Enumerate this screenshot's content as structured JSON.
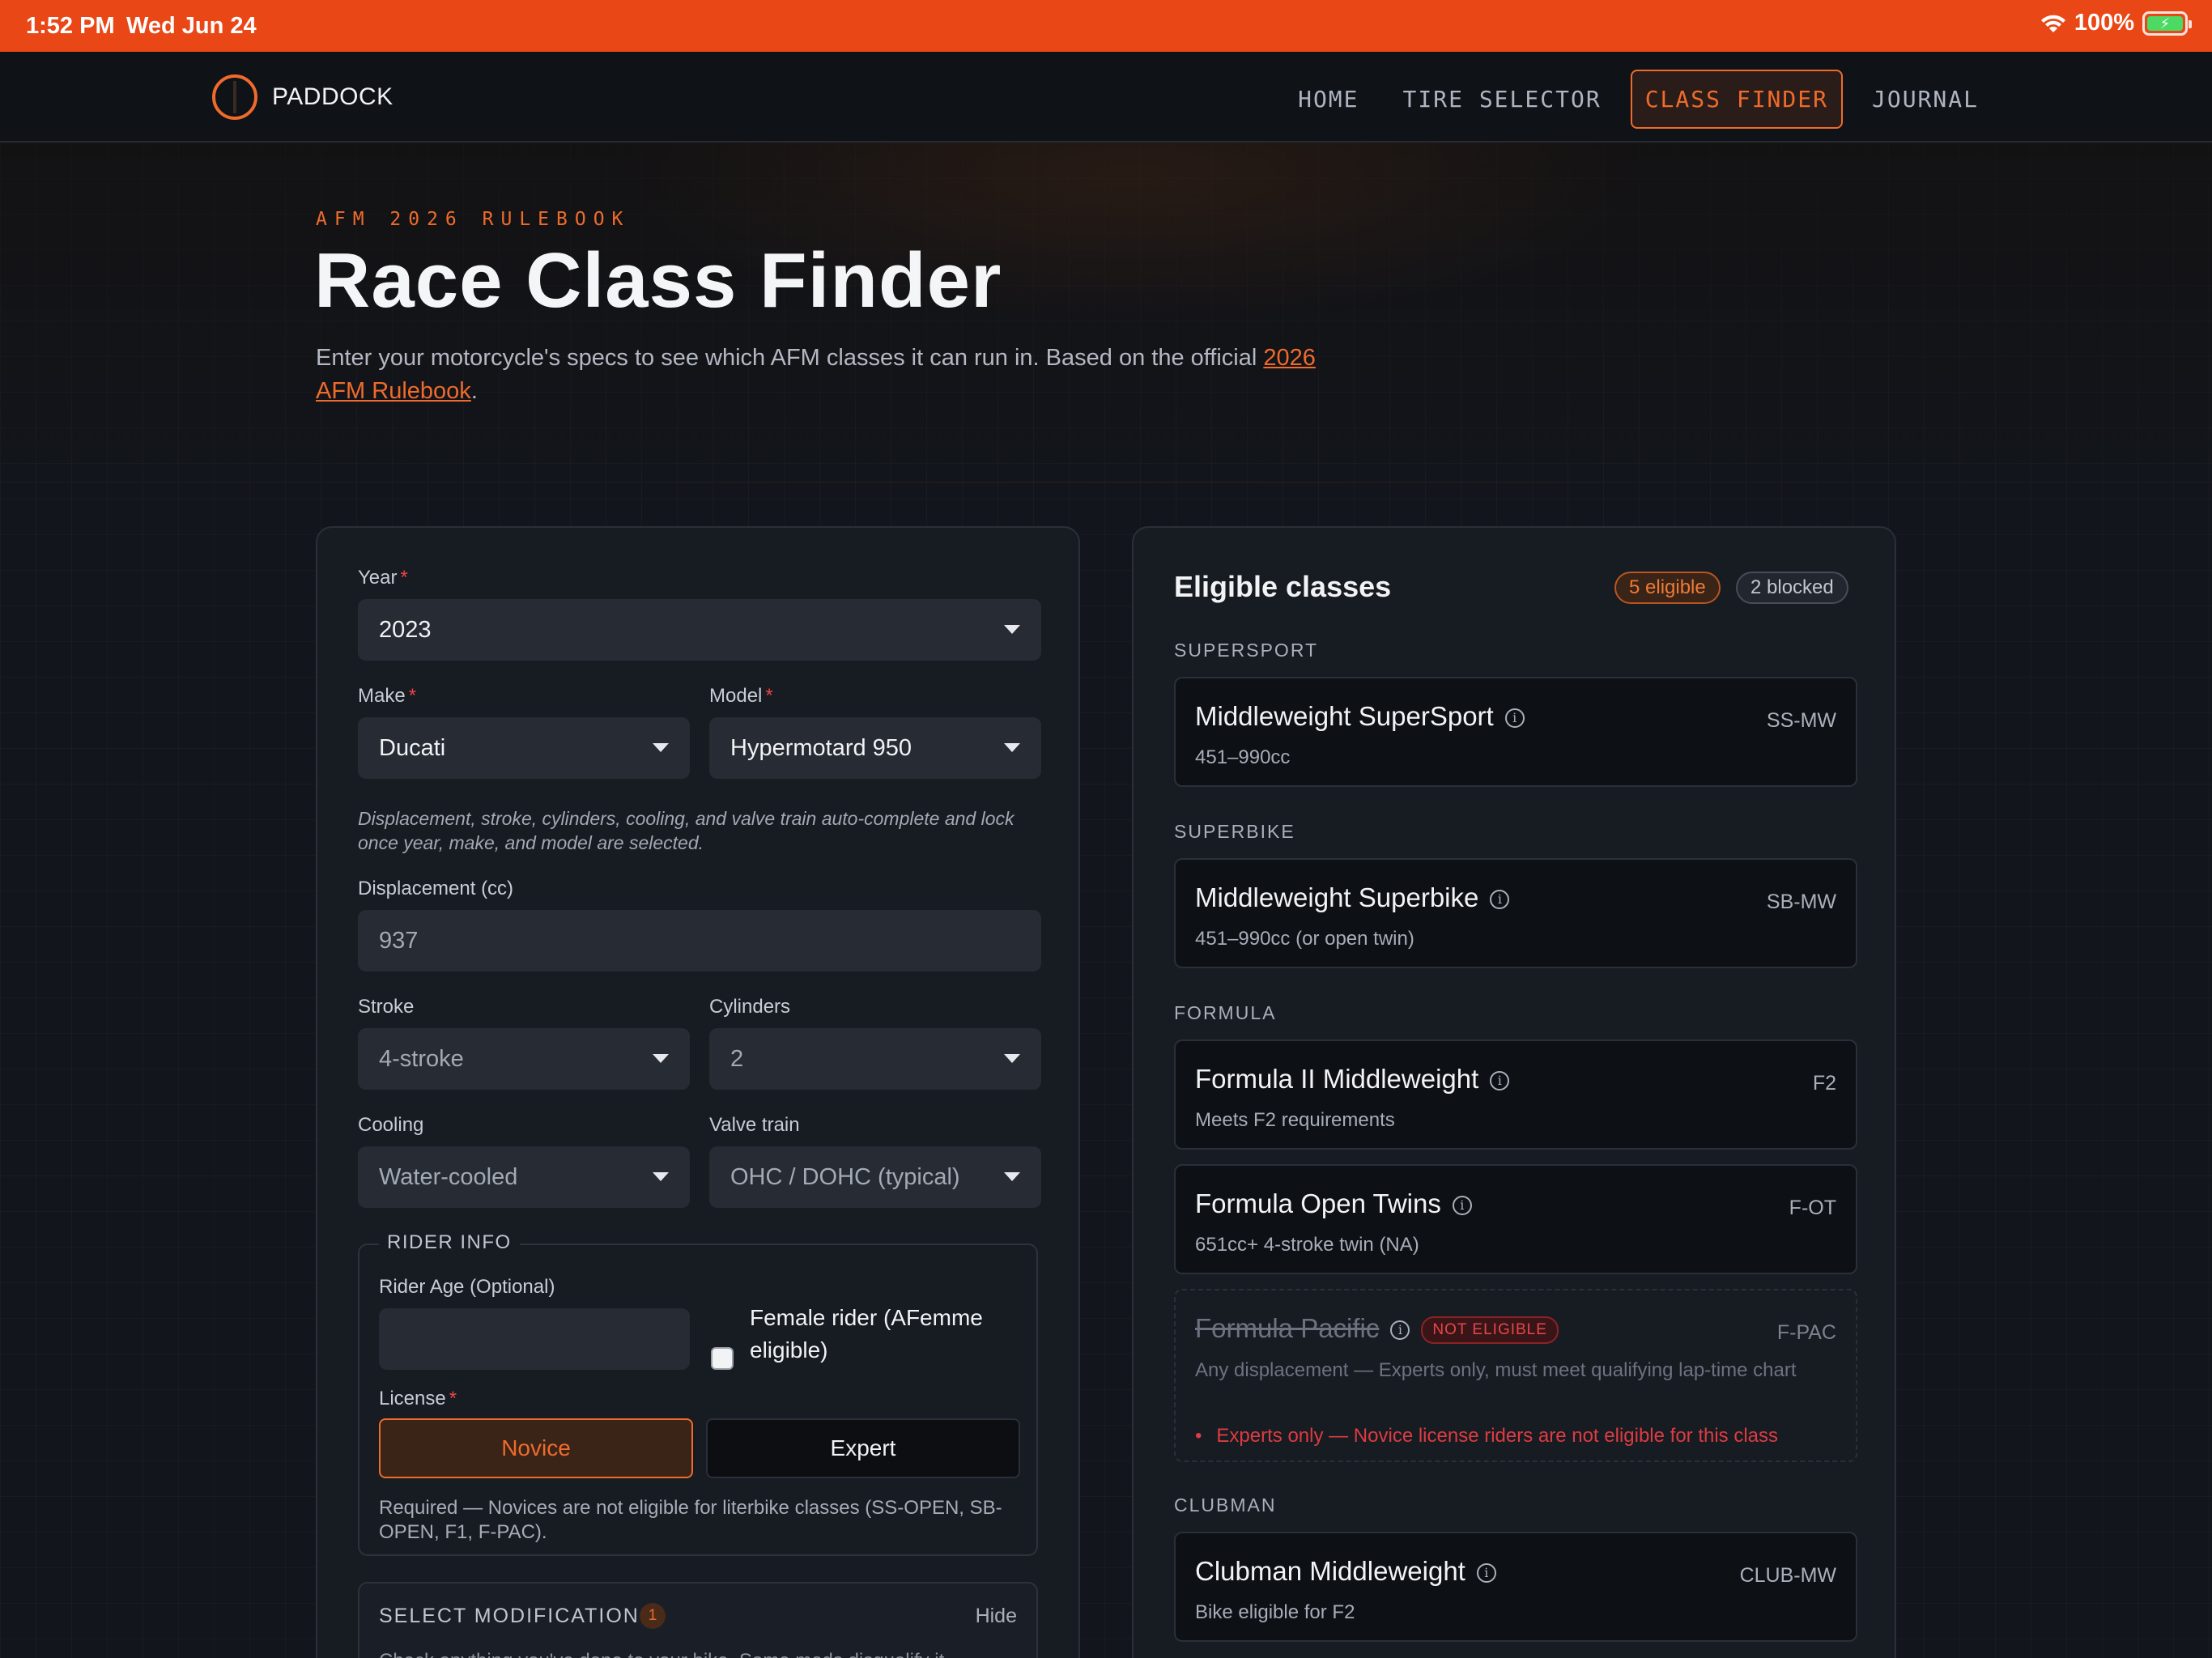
{
  "status_bar": {
    "time": "1:52 PM",
    "date": "Wed Jun 24",
    "battery": "100%"
  },
  "nav": {
    "logo": "PADDOCK",
    "links": [
      "HOME",
      "TIRE SELECTOR",
      "CLASS FINDER",
      "JOURNAL"
    ],
    "active": "CLASS FINDER"
  },
  "header": {
    "eyebrow": "AFM 2026 RULEBOOK",
    "title": "Race Class Finder",
    "intro": "Enter your motorcycle's specs to see which AFM classes it can run in. Based on the official ",
    "link_text": "2026 AFM Rulebook",
    "intro_end": "."
  },
  "form": {
    "year": {
      "label": "Year",
      "value": "2023"
    },
    "make": {
      "label": "Make",
      "value": "Ducati"
    },
    "model": {
      "label": "Model",
      "value": "Hypermotard 950"
    },
    "hint": "Displacement, stroke, cylinders, cooling, and valve train auto-complete and lock once year, make, and model are selected.",
    "displacement": {
      "label": "Displacement (cc)",
      "value": "937"
    },
    "stroke": {
      "label": "Stroke",
      "value": "4-stroke"
    },
    "cylinders": {
      "label": "Cylinders",
      "value": "2"
    },
    "cooling": {
      "label": "Cooling",
      "value": "Water-cooled"
    },
    "valve_train": {
      "label": "Valve train",
      "value": "OHC / DOHC (typical)"
    },
    "rider_info": {
      "legend": "RIDER INFO",
      "age_label": "Rider Age (Optional)",
      "age_value": "",
      "female_label": "Female rider (AFemme eligible)",
      "female_checked": false,
      "license_label": "License",
      "license_options": [
        "Novice",
        "Expert"
      ],
      "license_selected": "Novice",
      "license_note": "Required — Novices are not eligible for literbike classes (SS-OPEN, SB-OPEN, F1, F-PAC)."
    },
    "modifications": {
      "title": "SELECT MODIFICATIONS",
      "count": "1",
      "toggle_label": "Hide",
      "description": "Check anything you've done to your bike. Some mods disqualify it"
    }
  },
  "results": {
    "title": "Eligible classes",
    "eligible_badge": "5 eligible",
    "blocked_badge": "2 blocked",
    "groups": [
      {
        "label": "SUPERSPORT",
        "classes": [
          {
            "name": "Middleweight SuperSport",
            "code": "SS-MW",
            "desc": "451–990cc"
          }
        ]
      },
      {
        "label": "SUPERBIKE",
        "classes": [
          {
            "name": "Middleweight Superbike",
            "code": "SB-MW",
            "desc": "451–990cc (or open twin)"
          }
        ]
      },
      {
        "label": "FORMULA",
        "classes": [
          {
            "name": "Formula II Middleweight",
            "code": "F2",
            "desc": "Meets F2 requirements"
          },
          {
            "name": "Formula Open Twins",
            "code": "F-OT",
            "desc": "651cc+ 4-stroke twin (NA)"
          },
          {
            "name": "Formula Pacific",
            "code": "F-PAC",
            "desc": "Any displacement — Experts only, must meet qualifying lap-time chart",
            "badge": "NOT ELIGIBLE",
            "reason": "Experts only — Novice license riders are not eligible for this class"
          }
        ]
      },
      {
        "label": "CLUBMAN",
        "classes": [
          {
            "name": "Clubman Middleweight",
            "code": "CLUB-MW",
            "desc": "Bike eligible for F2"
          }
        ]
      }
    ]
  },
  "colors": {
    "accent": "#ef6b2b",
    "status_bar": "#ea4716",
    "danger": "#e4474a",
    "background": "#12151b"
  }
}
